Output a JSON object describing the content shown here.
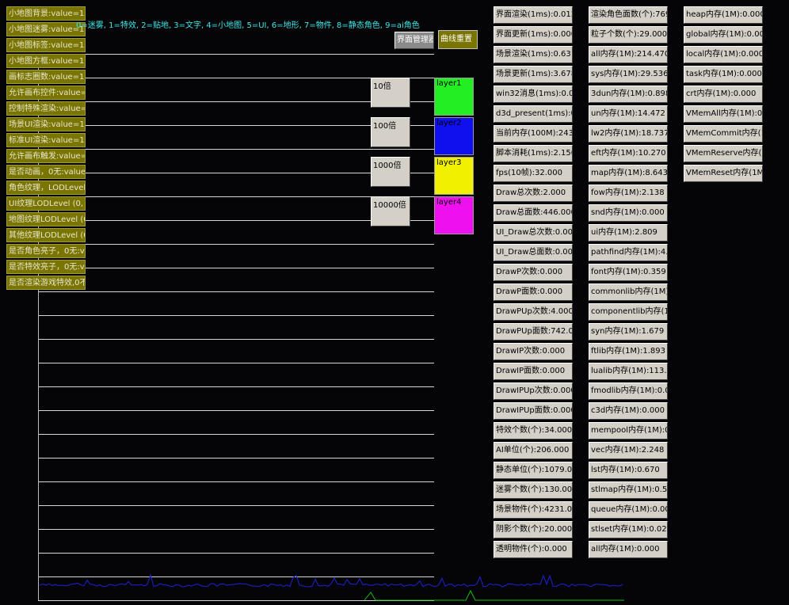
{
  "toggles": [
    "小地图背景:value=1",
    "小地图迷雾:value=1",
    "小地图标签:value=1",
    "小地图方框:value=1",
    "画标志圈数:value=1",
    "允许画布控件:value=1",
    "控制特殊渲染:value=0",
    "场景UI渲染:value=1",
    "标准UI渲染:value=1",
    "允许画布触发:value=1",
    "是否动画，0无:value=",
    "角色纹理，LODLevel",
    "UI纹理LODLevel (0,",
    "地图纹理LODLevel (0",
    "其他纹理LODLevel (0",
    "是否角色亮子，0无:va",
    "是否特效亮子，0无:va",
    "是否渲染游戏特效,0不"
  ],
  "hint": "0=迷雾, 1=特效, 2=贴地, 3=文字, 4=小地图, 5=UI, 6=地形, 7=物件, 8=静态角色, 9=ai角色",
  "buttons": {
    "ui_manager": "界面管理器",
    "curve_reset": "曲线重置"
  },
  "multipliers": [
    "10倍",
    "100倍",
    "1000倍",
    "10000倍"
  ],
  "layers": [
    {
      "label": "layer1",
      "color": "#22ee22"
    },
    {
      "label": "layer2",
      "color": "#1010ee"
    },
    {
      "label": "layer3",
      "color": "#f0f000"
    },
    {
      "label": "layer4",
      "color": "#ee10ee"
    }
  ],
  "stats_col1": [
    "界面渲染(1ms):0.012",
    "界面更新(1ms):0.000",
    "场景渲染(1ms):0.631",
    "场景更新(1ms):3.678",
    "win32消息(1ms):0.000",
    "d3d_present(1ms):0.2",
    "当前内存(100M):243.4",
    "脚本消耗(1ms):2.150",
    "fps(10帧):32.000",
    "Draw总次数:2.000",
    "Draw总面数:446.000",
    "UI_Draw总次数:0.000",
    "UI_Draw总面数:0.000",
    "DrawP次数:0.000",
    "DrawP面数:0.000",
    "DrawPUp次数:4.000",
    "DrawPUp面数:742.000",
    "DrawIP次数:0.000",
    "DrawIP面数:0.000",
    "DrawIPUp次数:0.000",
    "DrawIPUp面数:0.000",
    "特效个数(个):34.000",
    "AI单位(个):206.000",
    "静态单位(个):1079.000",
    "迷雾个数(个):130.000",
    "场景物件(个):4231.000",
    "阴影个数(个):20.000",
    "透明物件(个):0.000"
  ],
  "stats_col2": [
    "渲染角色面数(个):769",
    "粒子个数(个):29.000",
    "all内存(1M):214.470",
    "sys内存(1M):29.536",
    "3dun内存(1M):0.898",
    "un内存(1M):14.472",
    "lw2内存(1M):18.737",
    "eft内存(1M):10.270",
    "map内存(1M):8.643",
    "fow内存(1M):2.138",
    "snd内存(1M):0.000",
    "ui内存(1M):2.809",
    "pathfind内存(1M):4.48",
    "font内存(1M):0.359",
    "commonlib内存(1M):0",
    "componentlib内存(1M",
    "syn内存(1M):1.679",
    "ftlib内存(1M):1.893",
    "lualib内存(1M):113.768",
    "fmodlib内存(1M):0.086",
    "c3d内存(1M):0.000",
    "mempool内存(1M):0.0",
    "vec内存(1M):2.248",
    "lst内存(1M):0.670",
    "stlmap内存(1M):0.595",
    "queue内存(1M):0.000",
    "stlset内存(1M):0.029",
    "all内存(1M):0.000"
  ],
  "stats_col3": [
    "heap内存(1M):0.000",
    "global内存(1M):0.000",
    "local内存(1M):0.000",
    "task内存(1M):0.000",
    "crt内存(1M):0.000",
    "VMemAll内存(1M):0.00",
    "VMemCommit内存(1M",
    "VMemReserve内存(1M",
    "VMemReset内存(1M):0"
  ],
  "colors": {
    "graph_blue": "#2020d8",
    "graph_green": "#10c010",
    "olive": "#7a7400"
  }
}
